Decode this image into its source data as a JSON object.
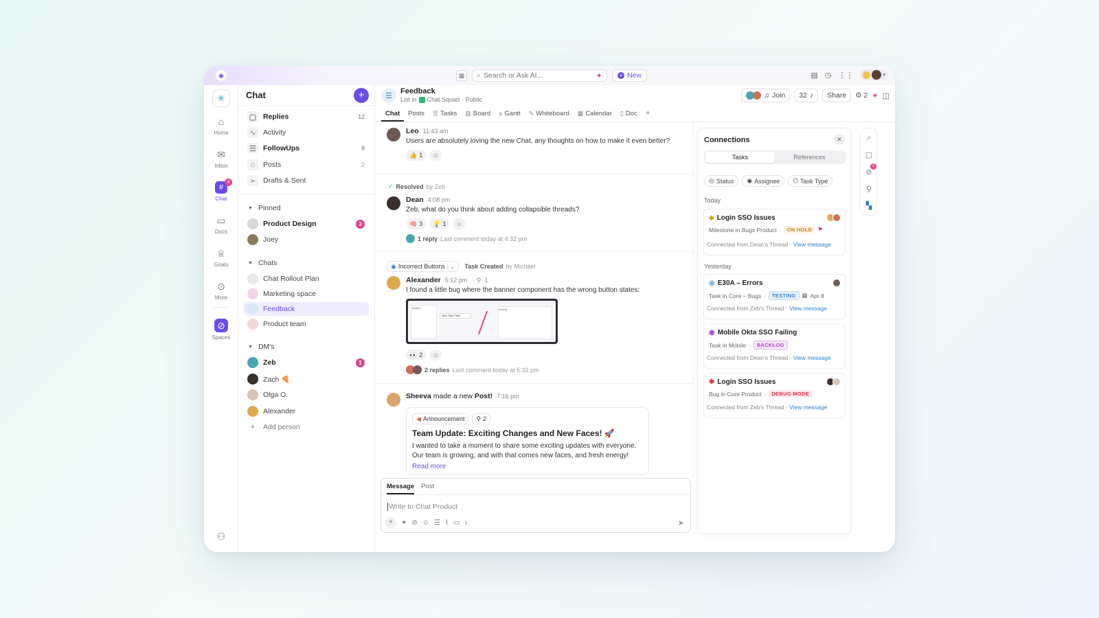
{
  "topbar": {
    "search_placeholder": "Search or Ask AI...",
    "new_label": "New"
  },
  "rail": {
    "items": [
      {
        "label": "Home"
      },
      {
        "label": "Inbox"
      },
      {
        "label": "Chat",
        "badge": "4"
      },
      {
        "label": "Docs"
      },
      {
        "label": "Goals"
      },
      {
        "label": "More"
      },
      {
        "label": "Spaces"
      }
    ]
  },
  "sidebar": {
    "title": "Chat",
    "top_items": [
      {
        "label": "Replies",
        "count": "12"
      },
      {
        "label": "Activity",
        "count": ""
      },
      {
        "label": "FollowUps",
        "count": "8"
      },
      {
        "label": "Posts",
        "count": "2"
      },
      {
        "label": "Drafts & Sent",
        "count": ""
      }
    ],
    "pinned_label": "Pinned",
    "pinned": [
      {
        "label": "Product Design",
        "badge": "3"
      },
      {
        "label": "Joey"
      }
    ],
    "chats_label": "Chats",
    "chats": [
      {
        "label": "Chat Rollout Plan"
      },
      {
        "label": "Marketing space"
      },
      {
        "label": "Feedback"
      },
      {
        "label": "Product team"
      }
    ],
    "dms_label": "DM's",
    "dms": [
      {
        "label": "Zeb",
        "badge": "1"
      },
      {
        "label": "Zach 🍕"
      },
      {
        "label": "Olga O."
      },
      {
        "label": "Alexander"
      }
    ],
    "add_person": "Add person"
  },
  "header": {
    "title": "Feedback",
    "list_in": "List in",
    "space": "Chat Squad",
    "visibility": "· Public",
    "join": "Join",
    "count": "32",
    "share": "Share",
    "share_count": "2"
  },
  "tabs": [
    "Chat",
    "Posts",
    "Tasks",
    "Board",
    "Gantt",
    "Whiteboard",
    "Calendar",
    "Doc"
  ],
  "messages": {
    "leo": {
      "name": "Leo",
      "time": "11:43 am",
      "text": "Users are absolutely loving the new Chat, any thoughts on how to make it even better?",
      "react": "👍",
      "react_count": "1"
    },
    "resolved": {
      "label": "Resolved",
      "by": "by Zeb"
    },
    "dean": {
      "name": "Dean",
      "time": "4:08 pm",
      "text": "Zeb, what do you think about adding collapsible threads?",
      "react1": "🧠",
      "react1_count": "3",
      "react2": "💡",
      "react2_count": "1",
      "reply_count": "1 reply",
      "reply_meta": "Last comment today at 4:32 pm"
    },
    "task": {
      "chip": "Incorrect Buttons",
      "created": "Task Created",
      "by": "by Michael"
    },
    "alexander": {
      "name": "Alexander",
      "time": "5:12 pm",
      "sub": "1",
      "text": "I found a little bug where the banner component has the wrong button states:",
      "react": "👀",
      "react_count": "2",
      "reply_count": "2 replies",
      "reply_meta": "Last comment today at 5:32 pm"
    },
    "sheeva": {
      "name": "Sheeva",
      "action": "made a new",
      "post": "Post!",
      "time": "7:16 pm",
      "chip": "Announcement",
      "chip_count": "2",
      "post_title": "Team Update: Exciting Changes and New Faces! 🚀",
      "post_body1": "I wanted to take a moment to share some exciting updates with everyone.",
      "post_body2": "Our team is growing, and with that comes new faces, and fresh energy!",
      "read_more": "Read more"
    }
  },
  "screenshot_preview": {
    "app_label": "Bottom",
    "button": "New Task FIML",
    "side": "Activity"
  },
  "composer": {
    "tab_message": "Message",
    "tab_post": "Post",
    "placeholder": "Write to Chat Product"
  },
  "connections": {
    "title": "Connections",
    "tab_tasks": "Tasks",
    "tab_refs": "References",
    "filters": [
      "Status",
      "Assignee",
      "Task Type"
    ],
    "today": "Today",
    "yesterday": "Yesterday",
    "cards": [
      {
        "title": "Login SSO Issues",
        "sub": "Milestone in Bugs Product",
        "status": "ON HOLD",
        "foot": "Connected from Dean's Thread",
        "link": "View message"
      },
      {
        "title": "E30A – Errors",
        "sub": "Task in Core – Bugs",
        "status": "TESTING",
        "date": "Apr 8",
        "foot": "Connected from Zeb's Thread",
        "link": "View message"
      },
      {
        "title": "Mobile Okta SSO Failing",
        "sub": "Task in Mobile",
        "status": "BACKLOG",
        "foot": "Connected from Dean's Thread",
        "link": "View message"
      },
      {
        "title": "Login SSO Issues",
        "sub": "Bug in Core Product",
        "status": "DEBUG MODE",
        "foot": "Connected from Zeb's Thread",
        "link": "View message"
      }
    ]
  },
  "right_rail_badge": "2",
  "colors": {
    "accent": "#6b4ce6",
    "badge": "#e0438a",
    "link": "#2b7fd0"
  }
}
